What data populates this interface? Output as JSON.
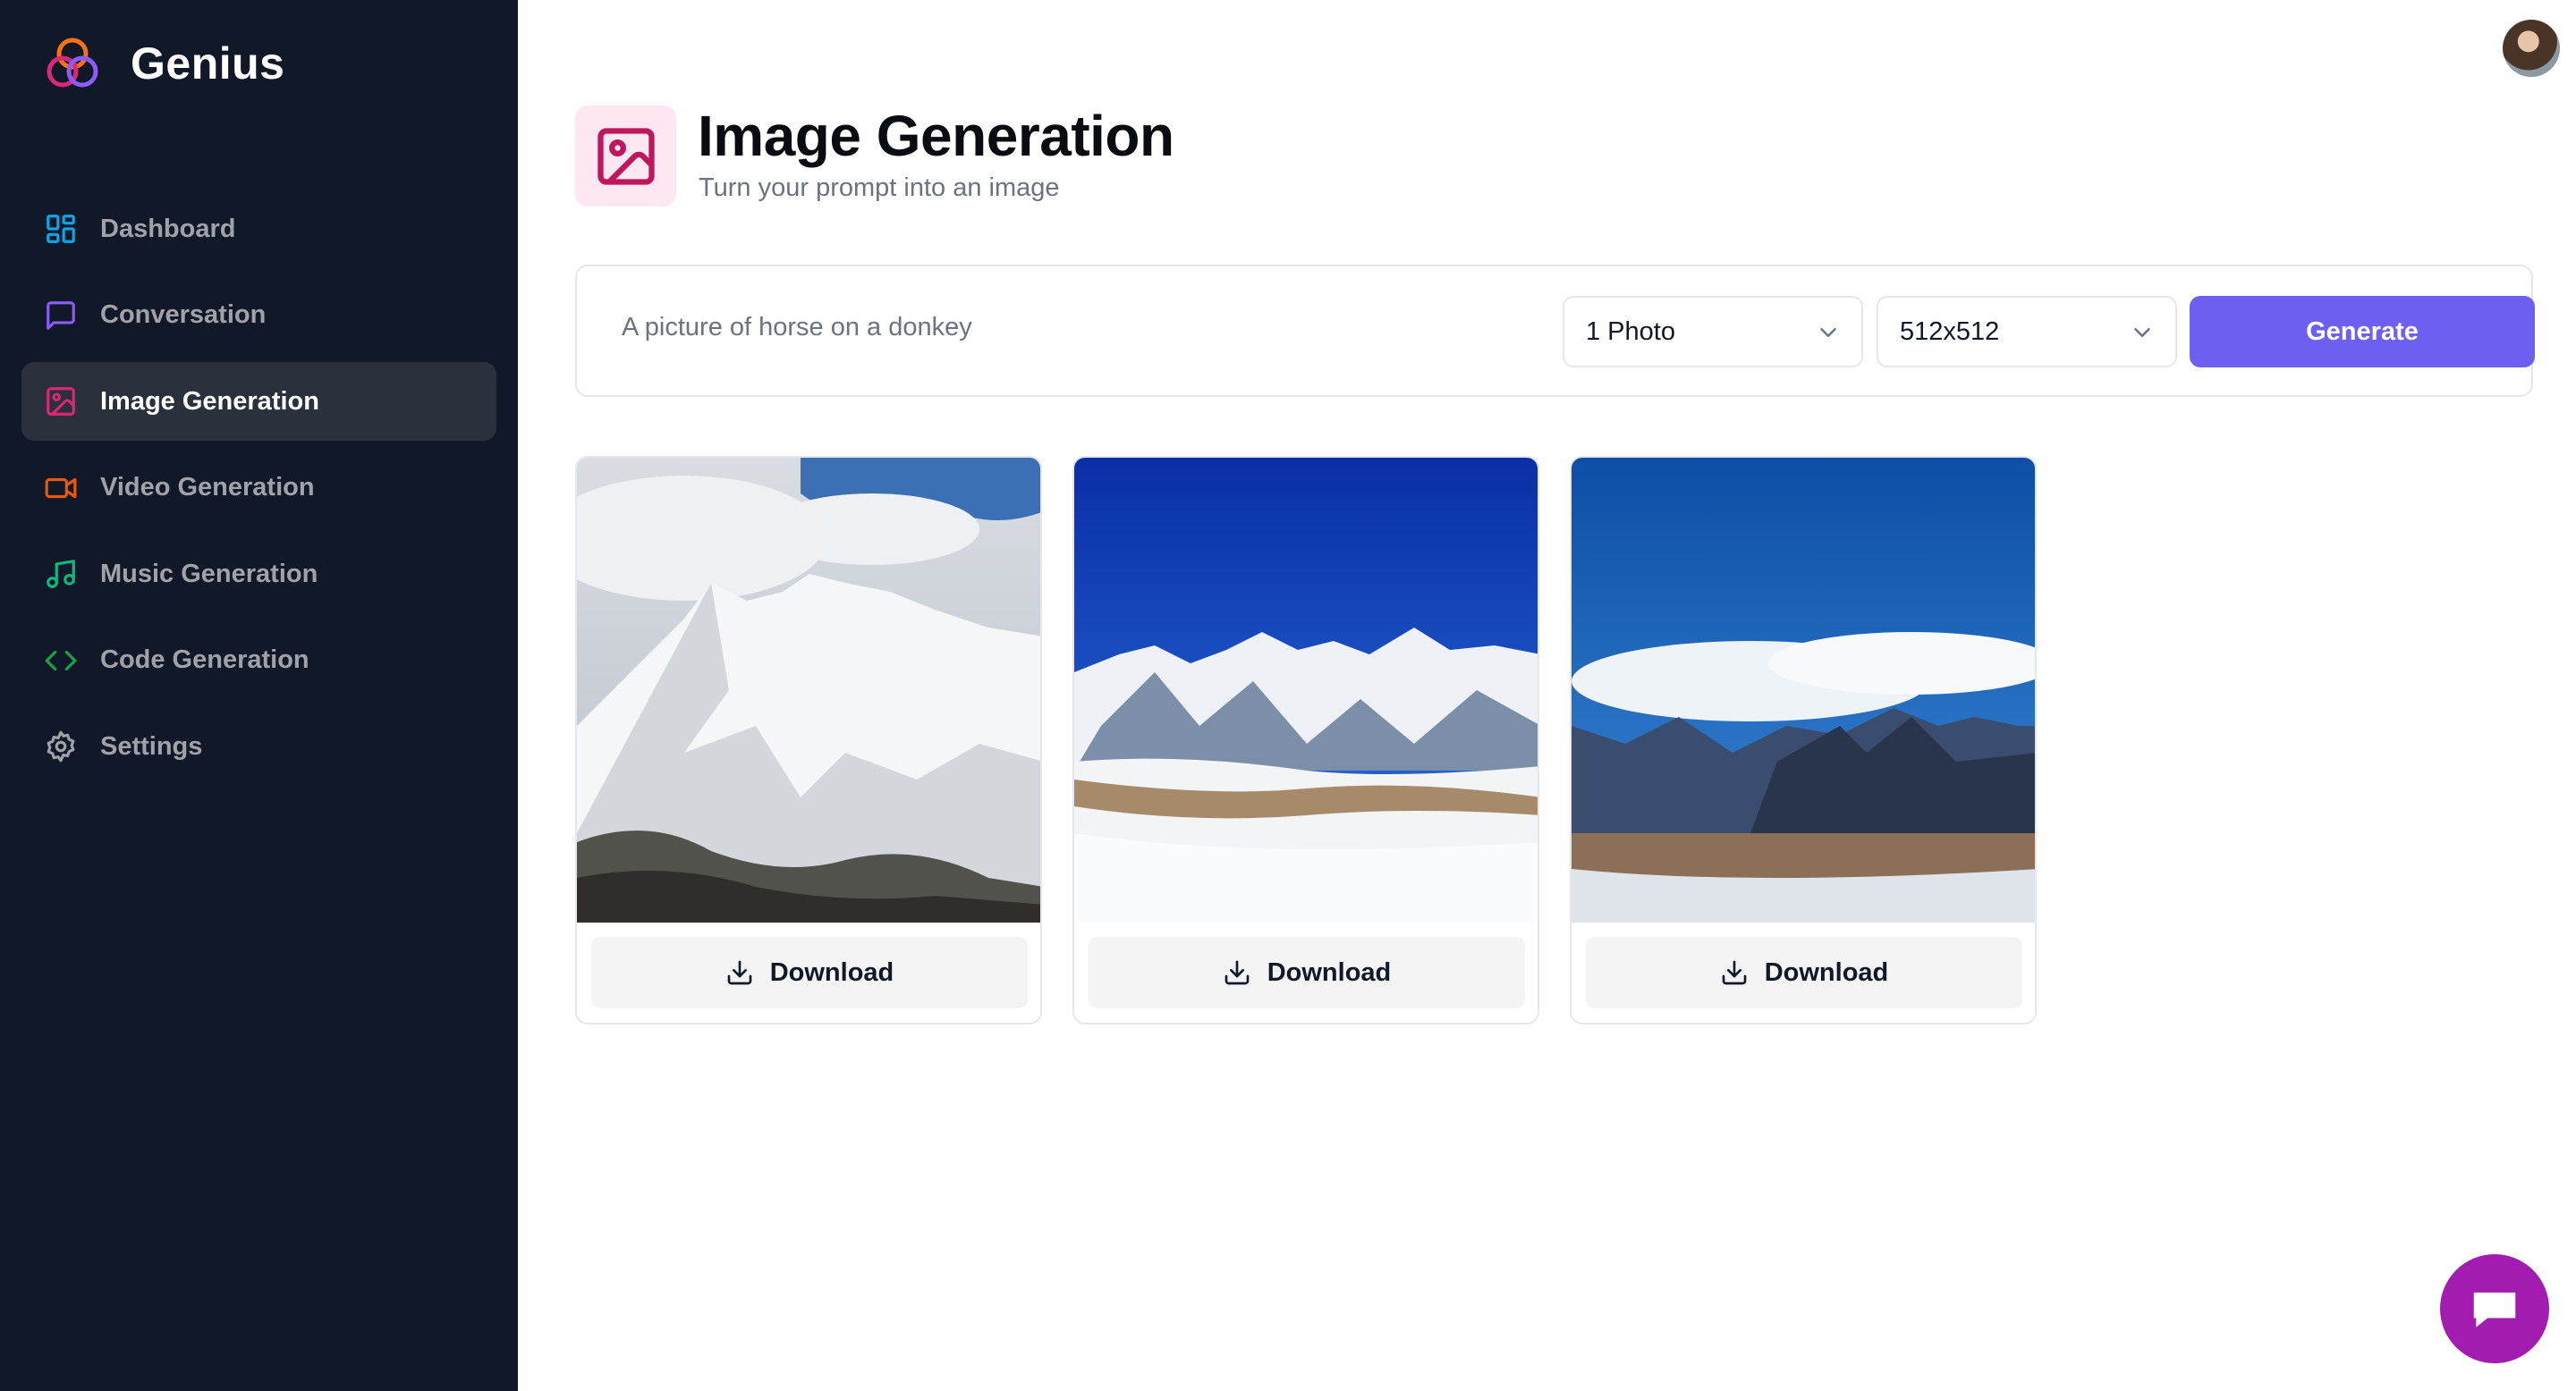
{
  "app": {
    "name": "Genius"
  },
  "sidebar": {
    "items": [
      {
        "label": "Dashboard",
        "icon": "dashboard-icon",
        "color": "#0ea5e9",
        "active": false
      },
      {
        "label": "Conversation",
        "icon": "message-square-icon",
        "color": "#8b5cf6",
        "active": false
      },
      {
        "label": "Image Generation",
        "icon": "image-icon",
        "color": "#db2777",
        "active": true
      },
      {
        "label": "Video Generation",
        "icon": "video-icon",
        "color": "#ea580c",
        "active": false
      },
      {
        "label": "Music Generation",
        "icon": "music-icon",
        "color": "#10b981",
        "active": false
      },
      {
        "label": "Code Generation",
        "icon": "code-icon",
        "color": "#16a34a",
        "active": false
      },
      {
        "label": "Settings",
        "icon": "settings-icon",
        "color": "#a1a1aa",
        "active": false
      }
    ]
  },
  "header": {
    "title": "Image Generation",
    "subtitle": "Turn your prompt into an image",
    "icon": "image-icon",
    "icon_color": "#be185d",
    "icon_bg": "#fce7f3"
  },
  "form": {
    "prompt_value": "A picture of horse on a donkey",
    "amount_selected": "1 Photo",
    "resolution_selected": "512x512",
    "generate_label": "Generate",
    "generate_color": "#6d5ff0"
  },
  "results": [
    {
      "download_label": "Download"
    },
    {
      "download_label": "Download"
    },
    {
      "download_label": "Download"
    }
  ],
  "chat": {
    "icon": "chat-icon",
    "color": "#a21caf"
  }
}
